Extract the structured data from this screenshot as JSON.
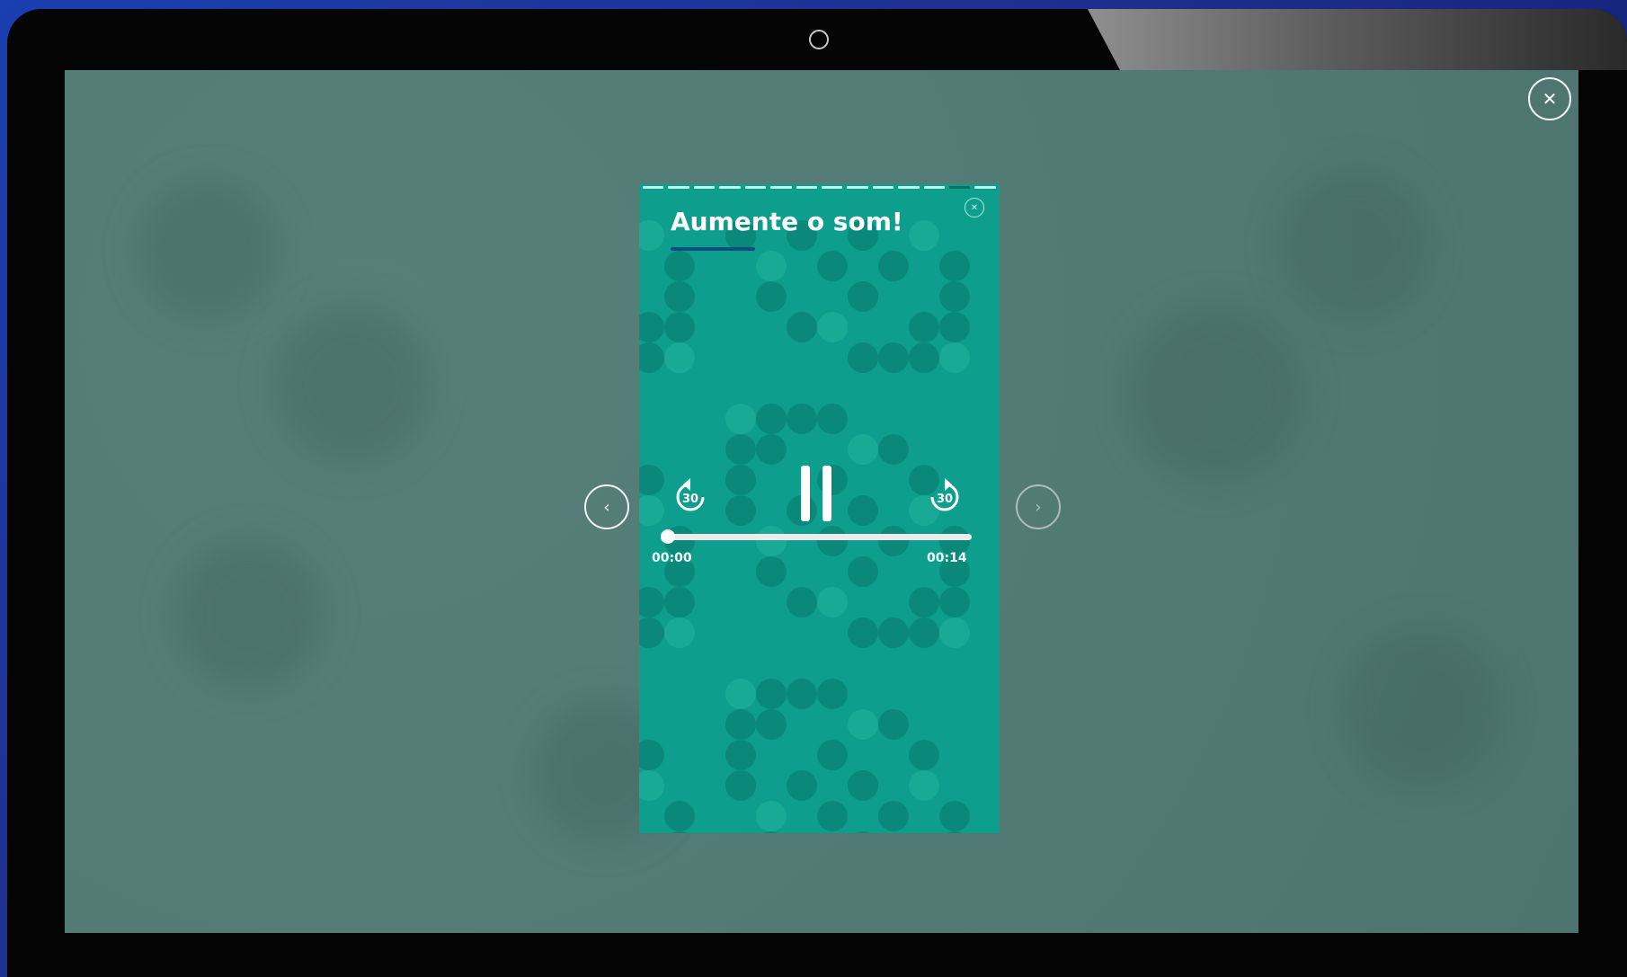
{
  "overlay": {
    "close_icon": "close-icon",
    "close_glyph": "✕",
    "prev_icon": "chevron-left-icon",
    "prev_glyph": "‹",
    "next_icon": "chevron-right-icon",
    "next_glyph": "›"
  },
  "story": {
    "title": "Aumente o som!",
    "close_icon": "close-icon",
    "close_glyph": "✕",
    "segments_total": 14,
    "current_segment": 12,
    "background_color": "#0e9e8d",
    "title_underline_color": "#0d4f7c"
  },
  "player": {
    "rewind_icon": "replay-30-icon",
    "rewind_label": "30",
    "pause_icon": "pause-icon",
    "forward_icon": "forward-30-icon",
    "forward_label": "30",
    "current_time": "00:00",
    "duration": "00:14",
    "progress_fraction": 0
  }
}
